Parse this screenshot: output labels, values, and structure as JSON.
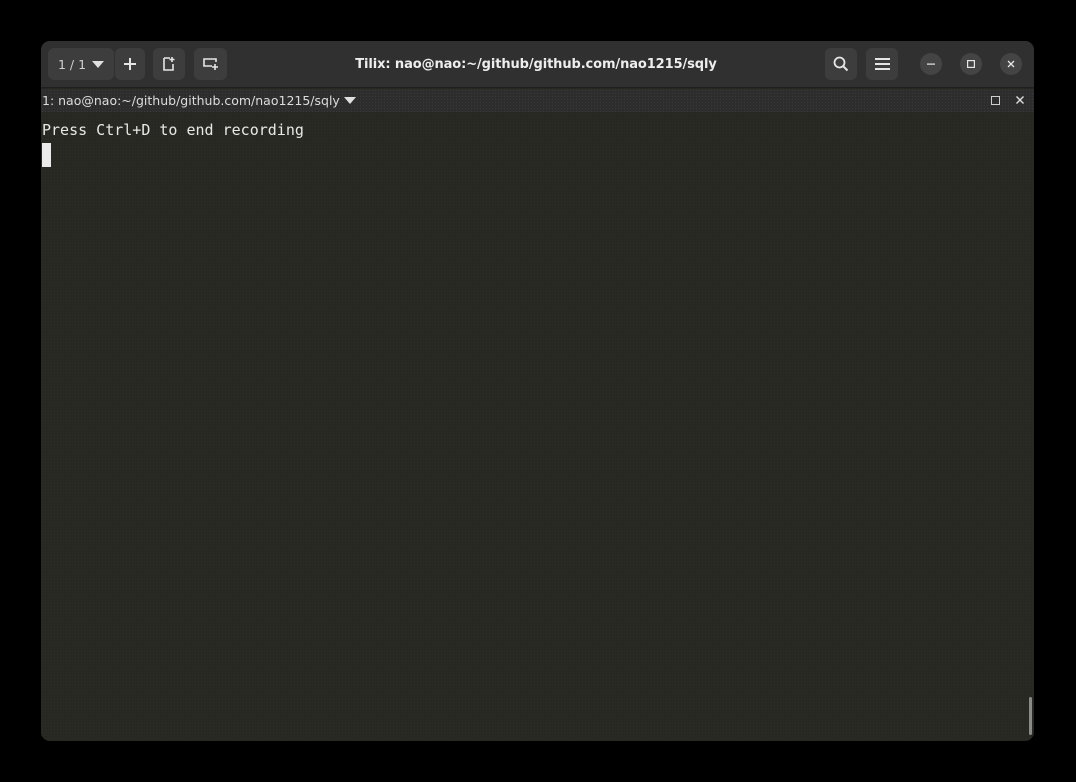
{
  "window": {
    "title": "Tilix: nao@nao:~/github/github.com/nao1215/sqly"
  },
  "headerbar": {
    "sessions_label": "1 / 1",
    "icons": {
      "sessions_dropdown": "chevron-down-icon",
      "add_session": "plus-icon",
      "split": "split-terminal-icon",
      "add_terminal": "add-terminal-icon",
      "search": "search-icon",
      "menu": "hamburger-menu-icon",
      "minimize": "minimize-icon",
      "maximize": "maximize-icon",
      "close": "close-icon"
    }
  },
  "terminal_bar": {
    "title": "1: nao@nao:~/github/github.com/nao1215/sqly",
    "icons": {
      "dropdown": "chevron-down-icon",
      "maximize": "maximize-icon",
      "close": "close-icon"
    }
  },
  "terminal": {
    "lines": [
      "Press Ctrl+D to end recording"
    ]
  },
  "colors": {
    "background": "#000000",
    "headerbar": "#303030",
    "button": "#3d3d3d",
    "terminal_bg": "#282822",
    "text": "#e8e8e8"
  }
}
